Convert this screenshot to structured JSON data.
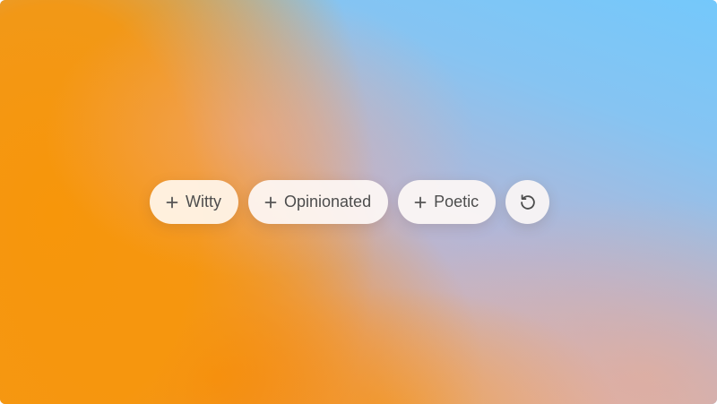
{
  "chips": [
    {
      "label": "Witty",
      "icon": "plus-icon"
    },
    {
      "label": "Opinionated",
      "icon": "plus-icon"
    },
    {
      "label": "Poetic",
      "icon": "plus-icon"
    }
  ],
  "reset_button": {
    "icon": "refresh-icon"
  },
  "colors": {
    "chip_text": "#4d4d4d",
    "chip_background": "#fdf8f5",
    "wallpaper_orange": "#f6960a",
    "wallpaper_blue": "#74c8fb"
  }
}
